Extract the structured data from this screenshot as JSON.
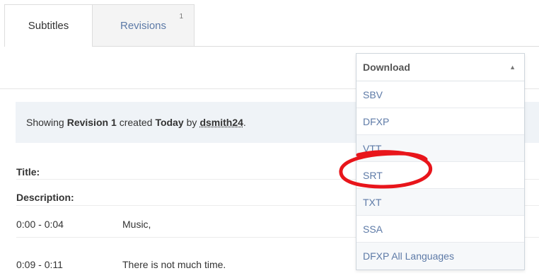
{
  "tabs": [
    {
      "label": "Subtitles",
      "active": true
    },
    {
      "label": "Revisions",
      "count": "1",
      "active": false
    }
  ],
  "download": {
    "label": "Download",
    "options": [
      "SBV",
      "DFXP",
      "VTT",
      "SRT",
      "TXT",
      "SSA",
      "DFXP All Languages"
    ],
    "highlighted_option": "SRT"
  },
  "revision_info": {
    "prefix": "Showing",
    "revision": "Revision 1",
    "created_text": "created",
    "when": "Today",
    "by_text": "by",
    "user": "dsmith24",
    "suffix": "."
  },
  "meta": {
    "title_label": "Title:",
    "description_label": "Description:"
  },
  "subtitles": [
    {
      "time": "0:00 - 0:04",
      "text": "Music,"
    },
    {
      "time": "0:09 - 0:11",
      "text": "There is not much time."
    }
  ],
  "colors": {
    "link": "#5d7aa7",
    "info_bg": "#eff3f7",
    "annotation": "#e8151b"
  }
}
